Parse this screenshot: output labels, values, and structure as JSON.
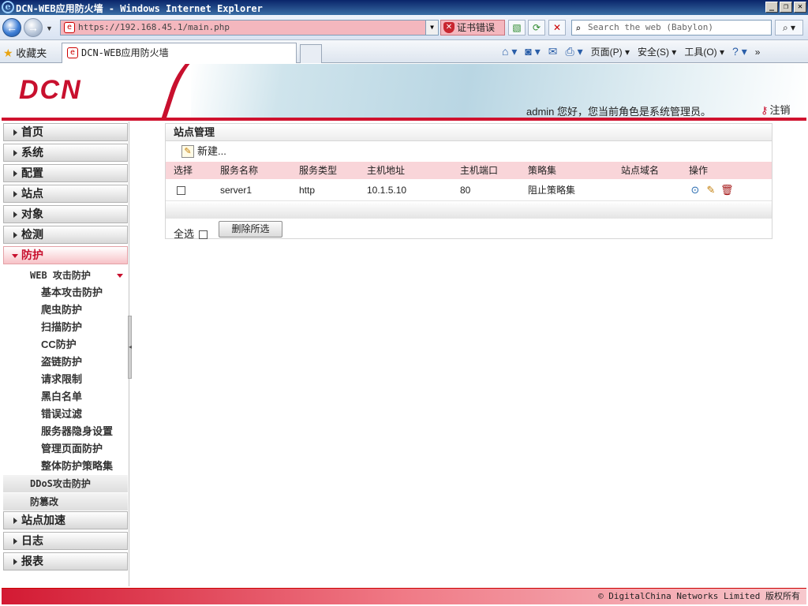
{
  "browser": {
    "window_title": "DCN-WEB应用防火墙 - Windows Internet Explorer",
    "url": "https://192.168.45.1/main.php",
    "cert_error": "证书错误",
    "search_placeholder": "Search the web (Babylon)",
    "favorites_label": "收藏夹",
    "tab_title": "DCN-WEB应用防火墙",
    "cmd_page": "页面(P)",
    "cmd_safety": "安全(S)",
    "cmd_tools": "工具(O)"
  },
  "header": {
    "logo": "DCN",
    "user_info": "admin 您好，您当前角色是系统管理员。",
    "logout": "注销"
  },
  "sidebar": {
    "items": [
      {
        "label": "首页"
      },
      {
        "label": "系统"
      },
      {
        "label": "配置"
      },
      {
        "label": "站点"
      },
      {
        "label": "对象"
      },
      {
        "label": "检测"
      },
      {
        "label": "防护"
      },
      {
        "label": "站点加速"
      },
      {
        "label": "日志"
      },
      {
        "label": "报表"
      }
    ],
    "web_group": "WEB 攻击防护",
    "web_subitems": [
      "基本攻击防护",
      "爬虫防护",
      "扫描防护",
      "CC防护",
      "盗链防护",
      "请求限制",
      "黑白名单",
      "错误过滤",
      "服务器隐身设置",
      "管理页面防护",
      "整体防护策略集"
    ],
    "ddos_group": "DDoS攻击防护",
    "tamper_group": "防篡改"
  },
  "main": {
    "panel_title": "站点管理",
    "new_button": "新建...",
    "columns": [
      "选择",
      "服务名称",
      "服务类型",
      "主机地址",
      "主机端口",
      "策略集",
      "站点域名",
      "操作"
    ],
    "rows": [
      {
        "name": "server1",
        "type": "http",
        "host": "10.1.5.10",
        "port": "80",
        "policy": "阻止策略集",
        "domain": ""
      }
    ],
    "select_all": "全选",
    "delete_selected": "删除所选"
  },
  "footer": {
    "copyright": "© DigitalChina Networks Limited",
    "rights": "版权所有"
  }
}
